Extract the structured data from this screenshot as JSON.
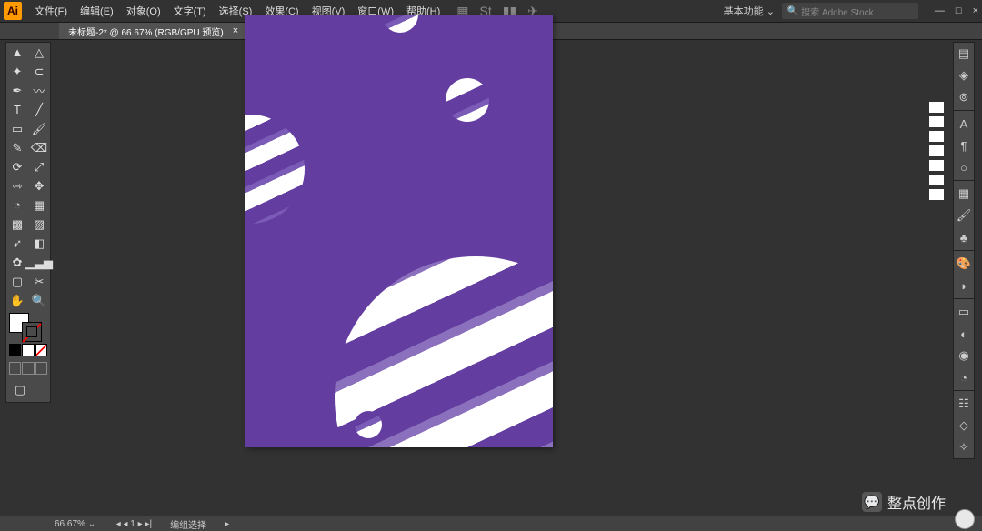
{
  "app": {
    "logo": "Ai"
  },
  "menu": [
    "文件(F)",
    "编辑(E)",
    "对象(O)",
    "文字(T)",
    "选择(S)",
    "效果(C)",
    "视图(V)",
    "窗口(W)",
    "帮助(H)"
  ],
  "workspace_switcher": "基本功能",
  "search": {
    "placeholder": "搜索 Adobe Stock",
    "icon": "🔍"
  },
  "window_buttons": {
    "min": "—",
    "max": "□",
    "close": "×"
  },
  "tab": {
    "title": "未标题-2* @ 66.67% (RGB/GPU 预览)",
    "close": "×"
  },
  "tools_left": [
    [
      "selection",
      "direct-select"
    ],
    [
      "wand",
      "lasso"
    ],
    [
      "pen",
      "curvature"
    ],
    [
      "type",
      "line"
    ],
    [
      "rect",
      "brush"
    ],
    [
      "shaper",
      "eraser"
    ],
    [
      "rotate",
      "scale"
    ],
    [
      "width",
      "free"
    ],
    [
      "shape-builder",
      "perspective"
    ],
    [
      "mesh",
      "gradient"
    ],
    [
      "eyedropper",
      "blend"
    ],
    [
      "symbol",
      "graph"
    ],
    [
      "artboard",
      "slice"
    ],
    [
      "hand",
      "zoom"
    ]
  ],
  "tool_icons": {
    "selection": "▲",
    "direct-select": "△",
    "wand": "✦",
    "lasso": "⊂",
    "pen": "✒",
    "curvature": "〰",
    "type": "T",
    "line": "╱",
    "rect": "▭",
    "brush": "🖌",
    "shaper": "✎",
    "eraser": "⌫",
    "rotate": "⟳",
    "scale": "⤢",
    "width": "⇿",
    "free": "✥",
    "shape-builder": "◔",
    "perspective": "▦",
    "mesh": "▩",
    "gradient": "▨",
    "eyedropper": "➶",
    "blend": "◧",
    "symbol": "✿",
    "graph": "▁▃▅",
    "artboard": "▢",
    "slice": "✂",
    "hand": "✋",
    "zoom": "🔍"
  },
  "color": {
    "fill": "#ffffff",
    "stroke": "none"
  },
  "mini_sw": [
    "#000000",
    "#ffffff",
    "none"
  ],
  "draw_modes": [
    "normal",
    "behind",
    "inside"
  ],
  "right_icons_top": [
    "properties",
    "layers",
    "cc-libraries"
  ],
  "right_icons_mid": [
    "character",
    "paragraph",
    "glyphs"
  ],
  "right_icons_3": [
    "swatches",
    "brushes",
    "symbols"
  ],
  "right_icons_4": [
    "color",
    "color-guide"
  ],
  "right_icons_5": [
    "stroke",
    "transparency",
    "appearance",
    "graphic-styles"
  ],
  "right_icons_6": [
    "align",
    "pathfinder",
    "transform"
  ],
  "right_glyphs": {
    "properties": "▤",
    "layers": "◈",
    "cc-libraries": "⊚",
    "character": "A",
    "paragraph": "¶",
    "glyphs": "○",
    "swatches": "▦",
    "brushes": "🖌",
    "symbols": "♣",
    "color": "🎨",
    "color-guide": "◗",
    "stroke": "▭",
    "transparency": "◐",
    "appearance": "◉",
    "graphic-styles": "◔",
    "align": "☷",
    "pathfinder": "◇",
    "transform": "✧"
  },
  "status": {
    "zoom": "66.67%",
    "page": "1",
    "label": "编组选择"
  },
  "watermark": {
    "icon": "💬",
    "text": "整点创作"
  },
  "artboard": {
    "bg": "#643da1"
  }
}
